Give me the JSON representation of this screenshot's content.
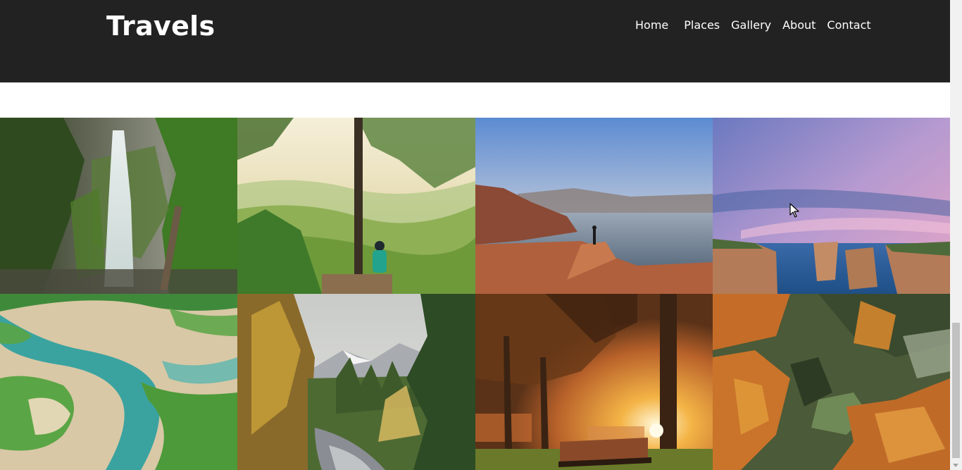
{
  "header": {
    "brand": "Travels",
    "nav": [
      "Home",
      "Places",
      "Gallery",
      "About",
      "Contact"
    ]
  },
  "colors": {
    "header_bg": "#222222",
    "header_text": "#ffffff",
    "page_bg": "#ffffff"
  },
  "gallery": {
    "photos": [
      "waterfall-photo",
      "tree-overlook-photo",
      "lake-cliff-photo",
      "coastal-rocks-photo",
      "river-delta-aerial-photo",
      "mountain-forest-stream-photo",
      "autumn-park-bench-photo",
      "autumn-forest-aerial-photo"
    ]
  }
}
